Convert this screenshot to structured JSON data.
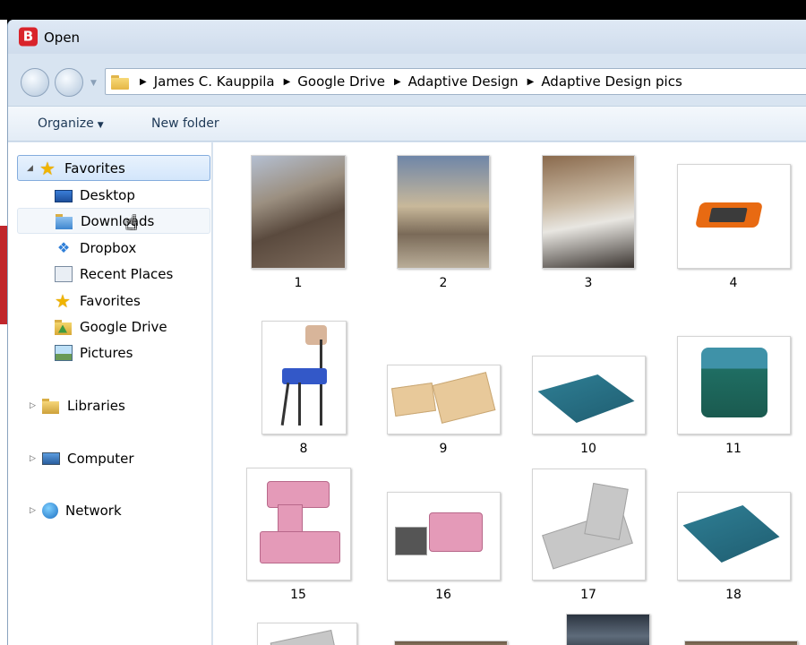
{
  "window": {
    "title": "Open",
    "app_logo_letter": "B"
  },
  "address_bar": {
    "crumbs": [
      "James C. Kauppila",
      "Google Drive",
      "Adaptive Design",
      "Adaptive Design pics"
    ]
  },
  "toolbar": {
    "organize_label": "Organize",
    "new_folder_label": "New folder"
  },
  "nav_pane": {
    "favorites_header": "Favorites",
    "favorites_items": [
      {
        "label": "Desktop",
        "icon": "desktop-icon"
      },
      {
        "label": "Downloads",
        "icon": "downloads-folder-icon"
      },
      {
        "label": "Dropbox",
        "icon": "dropbox-icon"
      },
      {
        "label": "Recent Places",
        "icon": "recent-places-icon"
      },
      {
        "label": "Favorites",
        "icon": "star-icon"
      },
      {
        "label": "Google Drive",
        "icon": "google-drive-icon"
      },
      {
        "label": "Pictures",
        "icon": "pictures-icon"
      }
    ],
    "libraries": "Libraries",
    "computer": "Computer",
    "network": "Network"
  },
  "files": [
    {
      "label": "1",
      "kind": "photo"
    },
    {
      "label": "2",
      "kind": "photo"
    },
    {
      "label": "3",
      "kind": "photo"
    },
    {
      "label": "4",
      "kind": "orange tablet stand"
    },
    {
      "label": "8",
      "kind": "chair"
    },
    {
      "label": "9",
      "kind": "cardboard pieces"
    },
    {
      "label": "10",
      "kind": "teal slant board"
    },
    {
      "label": "11",
      "kind": "teal cube seat"
    },
    {
      "label": "15",
      "kind": "pink model"
    },
    {
      "label": "16",
      "kind": "pink table model"
    },
    {
      "label": "17",
      "kind": "gray model"
    },
    {
      "label": "18",
      "kind": "teal slant board"
    }
  ],
  "colors": {
    "selection_border": "#84acdd",
    "toolbar_text": "#1e3957",
    "app_logo": "#d9242b"
  }
}
